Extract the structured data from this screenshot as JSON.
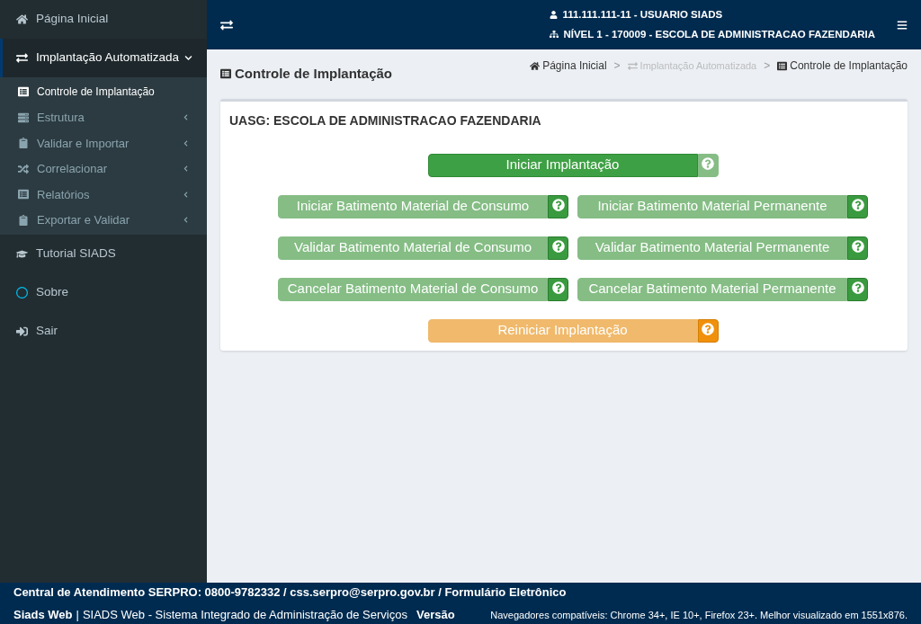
{
  "sidebar": {
    "items": [
      {
        "label": "Página Inicial",
        "selected": false
      },
      {
        "label": "Implantação Automatizada",
        "selected": true,
        "expanded": true,
        "children": [
          {
            "label": "Controle de Implantação",
            "selected": true,
            "has_submenu": false
          },
          {
            "label": "Estrutura",
            "selected": false,
            "has_submenu": true
          },
          {
            "label": "Validar e Importar",
            "selected": false,
            "has_submenu": true
          },
          {
            "label": "Correlacionar",
            "selected": false,
            "has_submenu": true
          },
          {
            "label": "Relatórios",
            "selected": false,
            "has_submenu": true
          },
          {
            "label": "Exportar e Validar",
            "selected": false,
            "has_submenu": true
          }
        ]
      },
      {
        "label": "Tutorial SIADS",
        "selected": false
      },
      {
        "label": "Sobre",
        "selected": false
      },
      {
        "label": "Sair",
        "selected": false
      }
    ]
  },
  "header": {
    "user": "111.111.111-11 - USUARIO SIADS",
    "level": "NÍVEL 1 - 170009 - ESCOLA DE ADMINISTRACAO FAZENDARIA"
  },
  "page": {
    "title": "Controle de Implantação",
    "breadcrumb": [
      {
        "label": "Página Inicial",
        "disabled": false
      },
      {
        "label": "Implantação Automatizada",
        "disabled": true,
        "separator": ">"
      },
      {
        "label": "Controle de Implantação",
        "disabled": false,
        "separator": ">"
      }
    ]
  },
  "card": {
    "title": "UASG: ESCOLA DE ADMINISTRACAO FAZENDARIA",
    "rows": [
      [
        {
          "label": "Iniciar Implantação",
          "kind": "success",
          "disabled": false,
          "help_disabled": true
        }
      ],
      [
        {
          "label": "Iniciar Batimento Material de Consumo",
          "kind": "success",
          "disabled": true,
          "help_disabled": false
        },
        {
          "label": "Iniciar Batimento Material Permanente",
          "kind": "success",
          "disabled": true,
          "help_disabled": false
        }
      ],
      [
        {
          "label": "Validar Batimento Material de Consumo",
          "kind": "success",
          "disabled": true,
          "help_disabled": false
        },
        {
          "label": "Validar Batimento Material Permanente",
          "kind": "success",
          "disabled": true,
          "help_disabled": false
        }
      ],
      [
        {
          "label": "Cancelar Batimento Material de Consumo",
          "kind": "success",
          "disabled": true,
          "help_disabled": false
        },
        {
          "label": "Cancelar Batimento Material Permanente",
          "kind": "success",
          "disabled": true,
          "help_disabled": false
        }
      ],
      [
        {
          "label": "Reiniciar Implantação",
          "kind": "warning",
          "disabled": true,
          "help_disabled": false
        }
      ]
    ]
  },
  "footer": {
    "contact": "Central de Atendimento SERPRO: 0800-9782332 / css.serpro@serpro.gov.br / Formulário Eletrônico",
    "brand": "Siads Web",
    "separator": "|",
    "system": "SIADS Web - Sistema Integrado de Administração de Serviços",
    "version": "Versão",
    "browsers": "Navegadores compatíveis: Chrome 34+, IE 10+, Firefox 23+. Melhor visualizado em 1551x876."
  }
}
